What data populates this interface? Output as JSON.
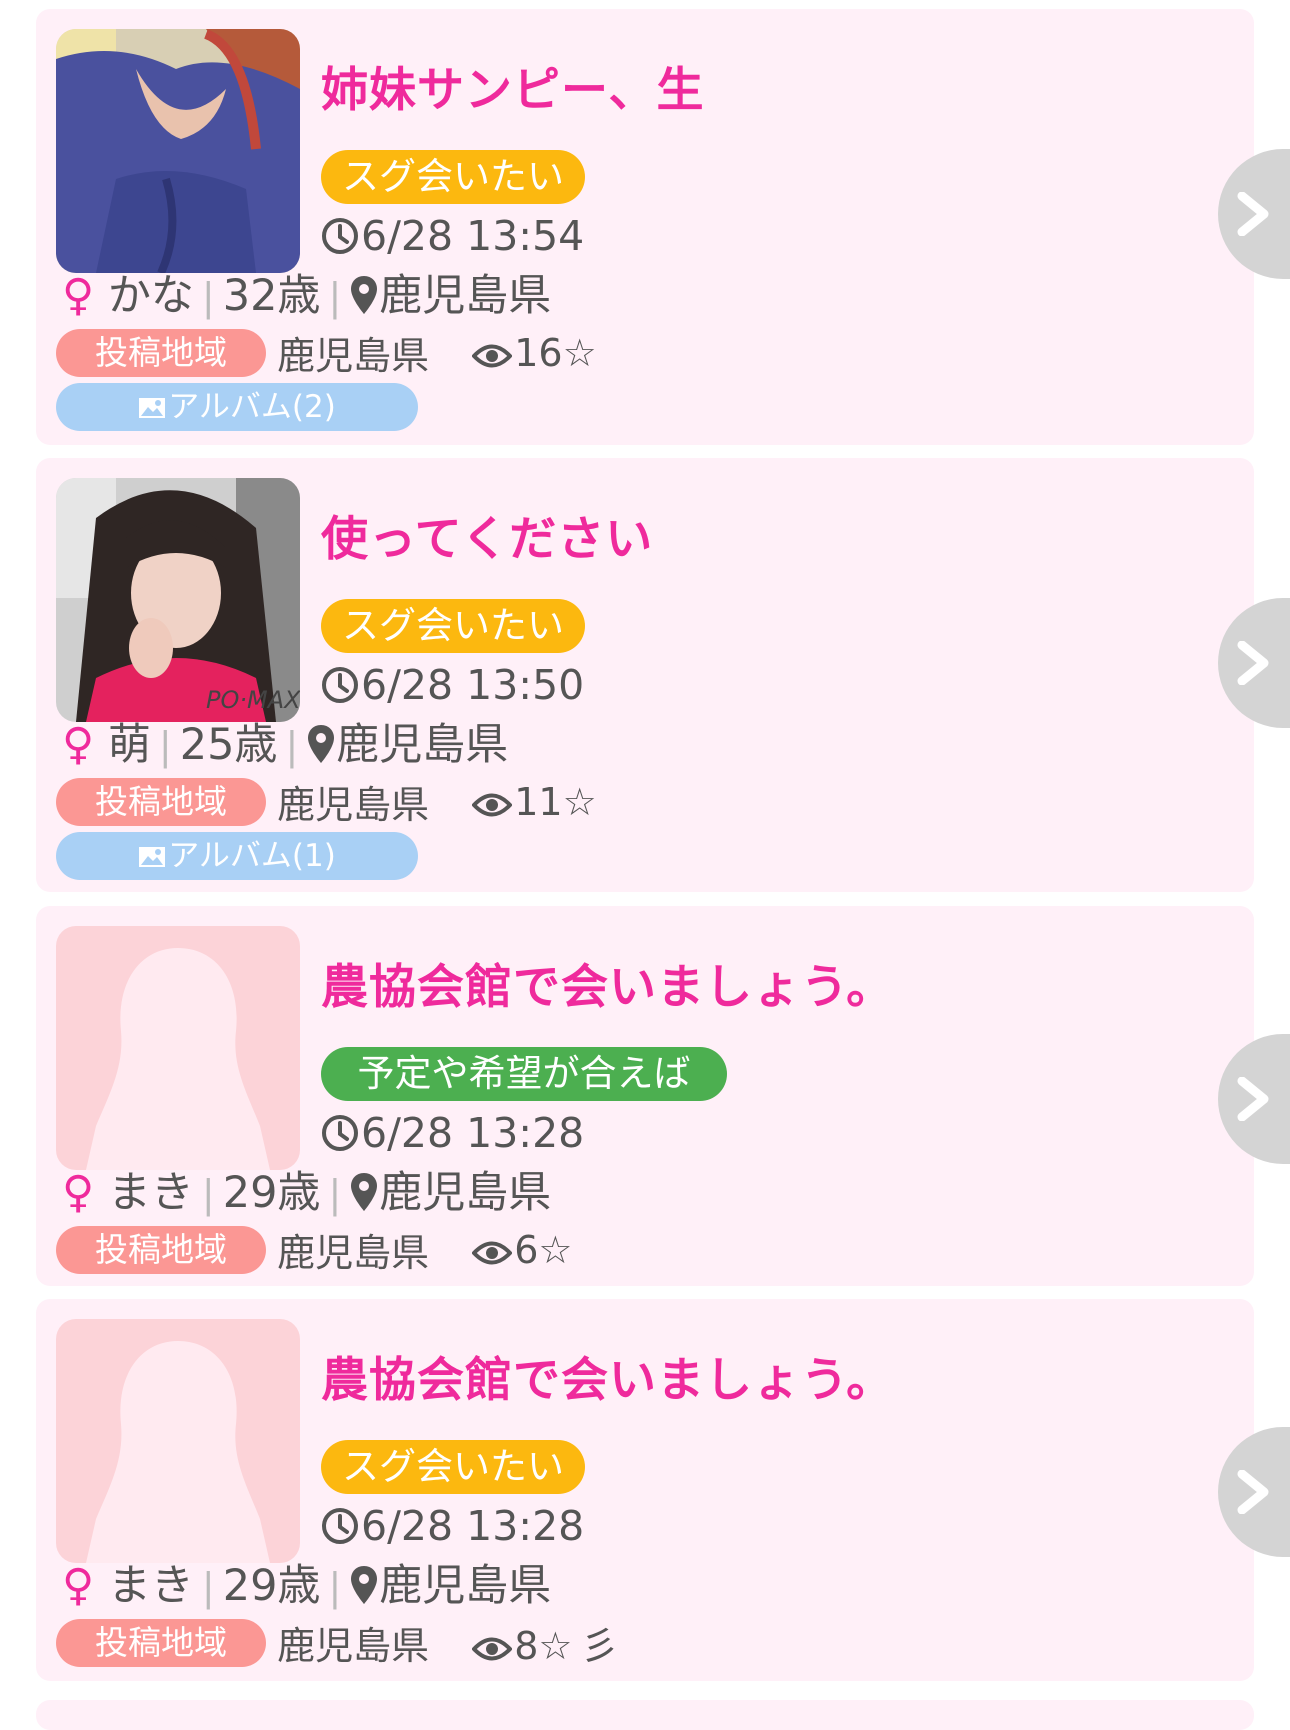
{
  "posts": [
    {
      "title": "姉妹サンピー、生",
      "tag": "スグ会いたい",
      "tag_color": "#fcb80f",
      "time": "6/28 13:54",
      "gender_symbol": "♀",
      "name": "かな",
      "age": "32歳",
      "location": "鹿児島県",
      "region_label": "投稿地域",
      "region": "鹿児島県",
      "views": "16",
      "star": "☆",
      "album": "アルバム(2)",
      "photo": "photo-woman-blue-top"
    },
    {
      "title": "使ってください",
      "tag": "スグ会いたい",
      "tag_color": "#fcb80f",
      "time": "6/28 13:50",
      "gender_symbol": "♀",
      "name": "萌",
      "age": "25歳",
      "location": "鹿児島県",
      "region_label": "投稿地域",
      "region": "鹿児島県",
      "views": "11",
      "star": "☆",
      "album": "アルバム(1)",
      "photo": "photo-woman-red-top"
    },
    {
      "title": "農協会館で会いましょう。",
      "tag": "予定や希望が合えば",
      "tag_color": "#4caf50",
      "time": "6/28 13:28",
      "gender_symbol": "♀",
      "name": "まき",
      "age": "29歳",
      "location": "鹿児島県",
      "region_label": "投稿地域",
      "region": "鹿児島県",
      "views": "6",
      "star": "☆",
      "photo": "silhouette-placeholder"
    },
    {
      "title": "農協会館で会いましょう。",
      "tag": "スグ会いたい",
      "tag_color": "#fcb80f",
      "time": "6/28 13:28",
      "gender_symbol": "♀",
      "name": "まき",
      "age": "29歳",
      "location": "鹿児島県",
      "region_label": "投稿地域",
      "region": "鹿児島県",
      "views": "8",
      "star": "☆",
      "extra_glyph": "彡",
      "photo": "silhouette-placeholder"
    }
  ],
  "colors": {
    "card_bg": "#fff0f8",
    "title": "#ef2a9c",
    "region_badge": "#fb9794",
    "album_badge": "#a9d0f5",
    "arrow_bg": "#d4d4d4"
  },
  "icons": {
    "time": "clock-icon",
    "location": "map-pin-icon",
    "views": "eye-icon",
    "album": "image-icon",
    "next": "chevron-right-icon"
  }
}
